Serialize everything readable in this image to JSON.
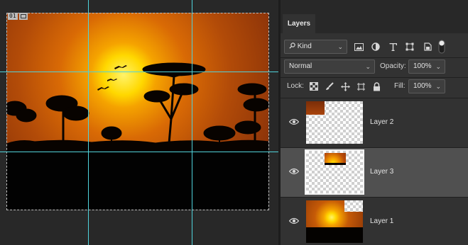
{
  "canvas": {
    "slice_number": "01",
    "icons": [
      "slice-badge-icon",
      "sun-icon",
      "tree-silhouette-icon",
      "bird-icon"
    ]
  },
  "panel": {
    "tab": "Layers",
    "filter": {
      "label": "Kind",
      "icon": "search-icon"
    },
    "filter_icons": [
      "image-filter-icon",
      "adjustment-filter-icon",
      "type-filter-icon",
      "shape-filter-icon",
      "smart-object-filter-icon",
      "filter-toggle-icon"
    ],
    "blend_mode": "Normal",
    "opacity_label": "Opacity:",
    "opacity_value": "100%",
    "lock_label": "Lock:",
    "lock_icons": [
      "lock-transparent-icon",
      "lock-image-icon",
      "lock-position-icon",
      "lock-artboard-icon",
      "lock-all-icon"
    ],
    "fill_label": "Fill:",
    "fill_value": "100%",
    "layers": [
      {
        "name": "Layer 2",
        "selected": false,
        "visible": true
      },
      {
        "name": "Layer 3",
        "selected": true,
        "visible": true
      },
      {
        "name": "Layer 1",
        "selected": false,
        "visible": true
      }
    ]
  },
  "colors": {
    "guide": "#4fd3dc",
    "panel_bg": "#323232",
    "selected_row": "#505050"
  }
}
